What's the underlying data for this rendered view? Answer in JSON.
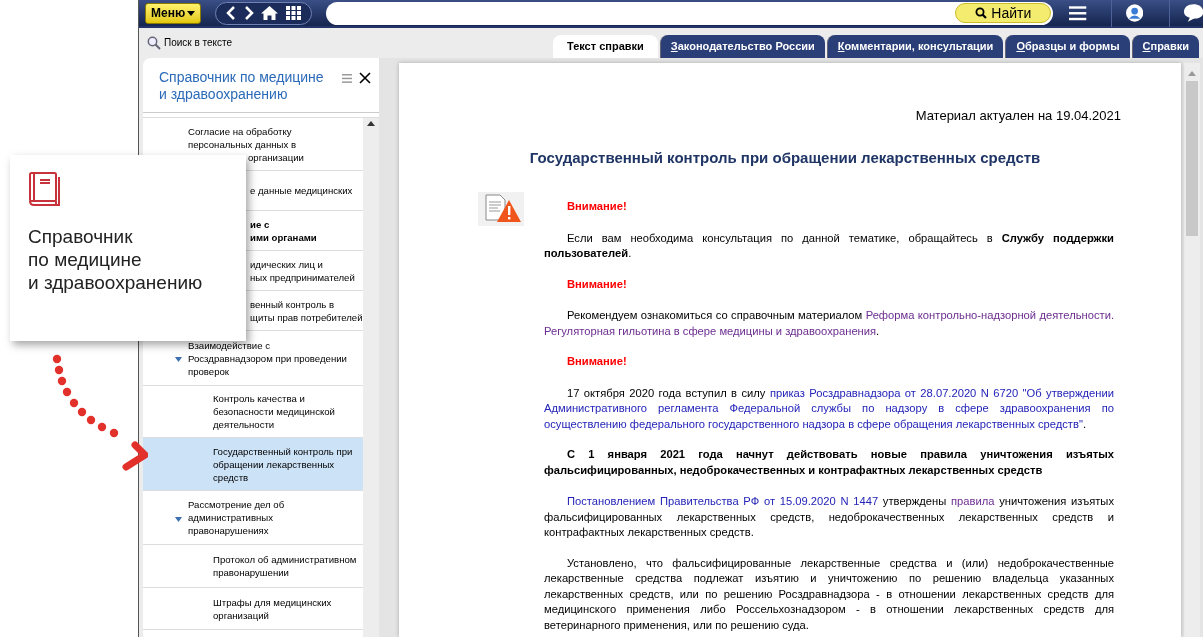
{
  "toolbar": {
    "menu_button": "Меню",
    "search": {
      "button": "Найти"
    }
  },
  "text_search": "Поиск в тексте",
  "tabs": [
    {
      "label": "Текст справки",
      "selected": true
    },
    {
      "label": "Законодательство России",
      "selected": false
    },
    {
      "label": "Комментарии, консультации",
      "selected": false
    },
    {
      "label": "Образцы и формы",
      "selected": false
    },
    {
      "label": "Справки",
      "selected": false
    }
  ],
  "sidebar": {
    "title": [
      "Справочник по медицине",
      "и здравоохранению"
    ],
    "items": [
      {
        "lines": [
          "Согласие на обработку",
          "персональных данных в"
        ],
        "right_lines": [
          "организации"
        ],
        "bold": false,
        "selected": false
      },
      {
        "right_lines": [
          "е данные медицинских"
        ],
        "bold": false,
        "selected": false
      },
      {
        "right_lines": [
          "ие с",
          "ими органами"
        ],
        "bold": true,
        "selected": false
      },
      {
        "right_lines": [
          "идических лиц и",
          "ных предпринимателей"
        ],
        "bold": false,
        "selected": false
      },
      {
        "right_lines": [
          "венный контроль в",
          "щиты прав потребителей"
        ],
        "bold": false,
        "selected": false
      },
      {
        "lines": [
          "Взаимодействие с",
          "Росздравнадзором при проведении",
          "проверок"
        ],
        "bold": false,
        "selected": false,
        "expanded": true,
        "children": [
          {
            "lines": [
              "Контроль качества и",
              "безопасности медицинской",
              "деятельности"
            ],
            "bold": false,
            "selected": false
          },
          {
            "lines": [
              "Государственный контроль при",
              "обращении лекарственных",
              "средств"
            ],
            "bold": false,
            "selected": true
          }
        ]
      },
      {
        "lines": [
          "Рассмотрение дел об",
          "административных",
          "правонарушениях"
        ],
        "bold": false,
        "selected": false,
        "expanded": true,
        "children": [
          {
            "lines": [
              "Протокол об административном",
              "правонарушении"
            ],
            "bold": false,
            "selected": false
          },
          {
            "lines": [
              "Штрафы для медицинских",
              "организаций"
            ],
            "bold": false,
            "selected": false
          }
        ]
      }
    ]
  },
  "callout": {
    "lines": [
      "Справочник",
      "по медицине",
      "и здравоохранению"
    ]
  },
  "document": {
    "actual": "Материал актуален на 19.04.2021",
    "title": "Государственный контроль при обращении лекарственных средств",
    "paragraphs": [
      {
        "kind": "warning",
        "text": "Внимание!"
      },
      {
        "kind": "text",
        "segments": [
          {
            "kind": "plain",
            "text": "Если вам необходима консультация по данной тематике, обращайтесь в **Службу поддержки пользователей**."
          }
        ]
      },
      {
        "kind": "warning",
        "text": "Внимание!"
      },
      {
        "kind": "text",
        "segments": [
          {
            "kind": "plain",
            "text": "Рекомендуем ознакомиться со справочным материалом "
          },
          {
            "kind": "link",
            "visited": true,
            "text": "Реформа контрольно-надзорной деятельности."
          },
          {
            "kind": "link",
            "visited": true,
            "text": "Регуляторная гильотина в сфере медицины и здравоохранения"
          },
          {
            "kind": "plain",
            "text": "."
          }
        ]
      },
      {
        "kind": "warning",
        "text": "Внимание!"
      },
      {
        "kind": "text",
        "segments": [
          {
            "kind": "plain",
            "text": "17 октября 2020 года вступил в силу "
          },
          {
            "kind": "link",
            "visited": false,
            "text": "приказ Росздравнадзора от 28.07.2020 N 6720 \"Об утверждении"
          },
          {
            "kind": "link",
            "visited": false,
            "text": "Административного регламента Федеральной службы по надзору в сфере здравоохранения по"
          },
          {
            "kind": "link",
            "visited": false,
            "text": "осуществлению федерального государственного надзора в сфере обращения лекарственных средств\""
          },
          {
            "kind": "plain",
            "text": "."
          }
        ]
      },
      {
        "kind": "heading",
        "text": "С 1 января 2021 года начнут действовать новые правила уничтожения изъятых фальсифицированных, недоброкачественных и контрафактных лекарственных средств"
      },
      {
        "kind": "text",
        "segments": [
          {
            "kind": "link",
            "visited": false,
            "text": "Постановлением Правительства РФ от 15.09.2020 N 1447"
          },
          {
            "kind": "plain",
            "text": " утверждены "
          },
          {
            "kind": "link",
            "visited": true,
            "text": "правила"
          },
          {
            "kind": "plain",
            "text": " уничтожения изъятых фальсифицированных лекарственных средств, недоброкачественных лекарственных средств и контрафактных лекарственных средств."
          }
        ]
      },
      {
        "kind": "text",
        "segments": [
          {
            "kind": "plain",
            "text": "Установлено, что фальсифицированные лекарственные средства и (или) недоброкачественные лекарственные средства подлежат изъятию и уничтожению по решению владельца указанных лекарственных средств, или по решению Росздравнадзора - в отношении лекарственных средств для медицинского применения либо Россельхознадзором - в отношении лекарственных средств для ветеринарного применения, или по решению суда."
          }
        ]
      }
    ]
  }
}
